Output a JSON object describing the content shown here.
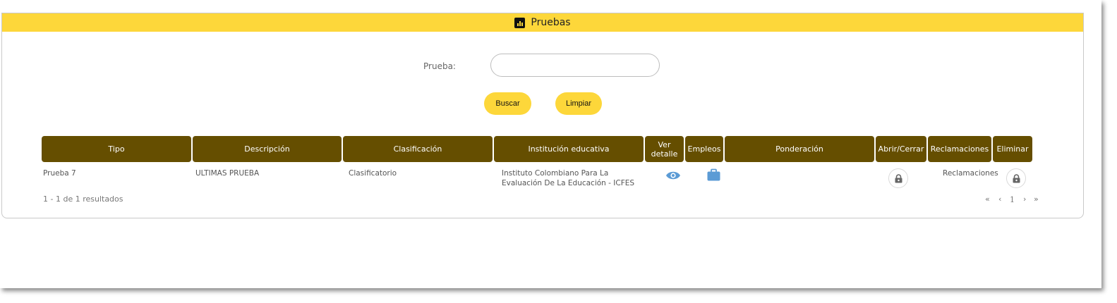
{
  "panel": {
    "title": "Pruebas",
    "title_icon": "bar-chart-icon"
  },
  "search": {
    "label": "Prueba:",
    "value": "",
    "placeholder": ""
  },
  "buttons": {
    "search_label": "Buscar",
    "clear_label": "Limpiar"
  },
  "table": {
    "columns": [
      "Tipo",
      "Descripción",
      "Clasificación",
      "Institución educativa",
      "Ver detalle",
      "Empleos",
      "Ponderación",
      "Abrir/Cerrar",
      "Reclamaciones",
      "Eliminar"
    ],
    "rows": [
      {
        "tipo": "Prueba 7",
        "descripcion": "ULTIMAS PRUEBA",
        "clasificacion": "Clasificatorio",
        "institucion_line1": "Instituto Colombiano Para La",
        "institucion_line2": "Evaluación De La Educación - ICFES",
        "ver_detalle_icon": "eye-icon",
        "empleos_icon": "briefcase-icon",
        "ponderacion": "",
        "abrir_cerrar_icon": "lock-icon",
        "reclamaciones": "Reclamaciones",
        "eliminar_icon": "lock-icon"
      }
    ]
  },
  "pagination": {
    "summary": "1 - 1 de 1 resultados",
    "first": "«",
    "prev": "‹",
    "current_page": "1",
    "next": "›",
    "last": "»"
  },
  "colors": {
    "accent_yellow": "#fdd73a",
    "header_brown": "#654e00",
    "icon_blue": "#5b9bd5"
  }
}
